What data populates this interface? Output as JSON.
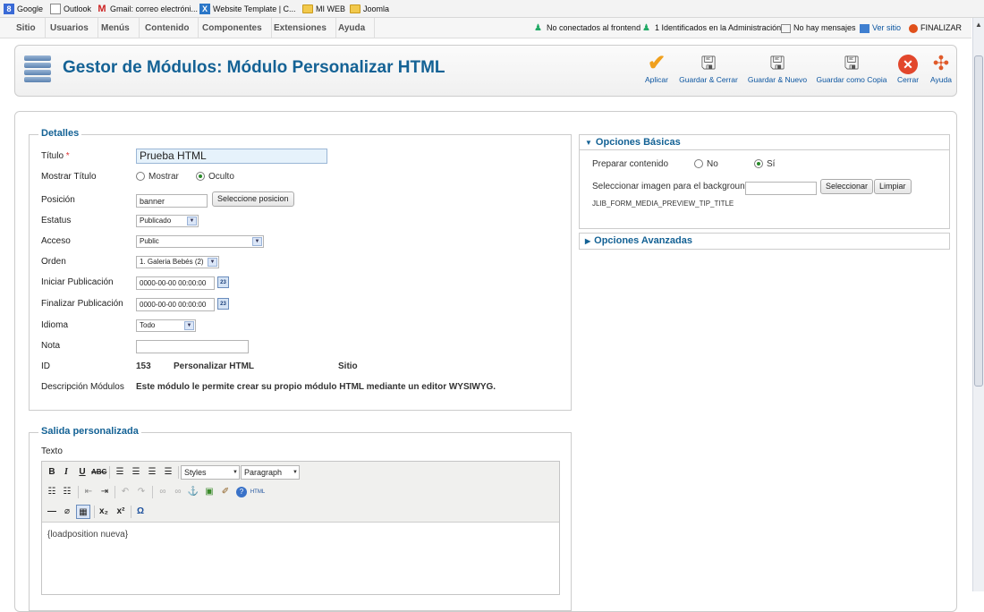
{
  "bookmarks": [
    "Google",
    "Outlook",
    "Gmail: correo electróni...",
    "Website Template | C...",
    "MI WEB",
    "Joomla"
  ],
  "menu": [
    "Sitio",
    "Usuarios",
    "Menús",
    "Contenido",
    "Componentes",
    "Extensiones",
    "Ayuda"
  ],
  "status": {
    "frontend": "No conectados al frontend",
    "admin": "1 Identificados en la Administración",
    "messages": "No hay mensajes",
    "view_site": "Ver sitio",
    "logout": "FINALIZAR"
  },
  "header": {
    "title": "Gestor de Módulos: Módulo Personalizar HTML"
  },
  "toolbar": [
    "Aplicar",
    "Guardar & Cerrar",
    "Guardar & Nuevo",
    "Guardar como Copia",
    "Cerrar",
    "Ayuda"
  ],
  "details": {
    "legend": "Detalles",
    "title_label": "Título",
    "required_mark": "*",
    "title_value": "Prueba HTML",
    "show_title_label": "Mostrar Título",
    "show_option": "Mostrar",
    "hide_option": "Oculto",
    "position_label": "Posición",
    "position_value": "banner",
    "select_position_button": "Seleccione posicion",
    "status_label": "Estatus",
    "status_value": "Publicado",
    "access_label": "Acceso",
    "access_value": "Public",
    "order_label": "Orden",
    "order_value": "1. Galeria Bebés (2)",
    "publish_up_label": "Iniciar Publicación",
    "publish_up_value": "0000-00-00 00:00:00",
    "publish_down_label": "Finalizar Publicación",
    "publish_down_value": "0000-00-00 00:00:00",
    "calendar_glyph": "23",
    "language_label": "Idioma",
    "language_value": "Todo",
    "note_label": "Nota",
    "note_value": "",
    "id_label": "ID",
    "id_value": "153",
    "id_type": "Personalizar HTML",
    "id_client": "Sitio",
    "description_label": "Descripción Módulos",
    "description_value": "Este módulo le permite crear su propio módulo HTML mediante un editor WYSIWYG."
  },
  "basic_options": {
    "title": "Opciones Básicas",
    "prepare_label": "Preparar contenido",
    "no_option": "No",
    "yes_option": "Sí",
    "bg_label": "Seleccionar imagen para el background",
    "bg_value": "",
    "select_button": "Seleccionar",
    "clear_button": "Limpiar",
    "tip": "JLIB_FORM_MEDIA_PREVIEW_TIP_TITLE"
  },
  "advanced_options": {
    "title": "Opciones Avanzadas"
  },
  "custom_output": {
    "legend": "Salida personalizada",
    "text_label": "Texto",
    "styles_dropdown": "Styles",
    "format_dropdown": "Paragraph",
    "content": "{loadposition nueva}"
  },
  "colors": {
    "accent": "#146295",
    "link": "#0b55a0"
  }
}
